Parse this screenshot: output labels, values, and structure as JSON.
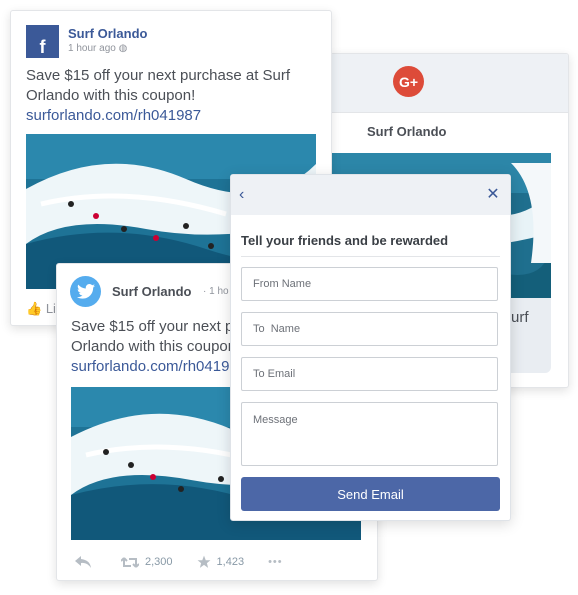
{
  "google_card": {
    "icon_label": "G+",
    "brand_color": "#dd4b39",
    "name": "Surf Orlando",
    "text_fragment": "urf"
  },
  "facebook_card": {
    "icon_label": "f",
    "brand_color": "#3b5998",
    "name": "Surf Orlando",
    "time": "1 hour ago",
    "text": "Save $15 off your next purchase at Surf Orlando with this coupon!",
    "link": "surforlando.com/rh041987",
    "like_label": "Li"
  },
  "twitter_card": {
    "brand_color": "#55acee",
    "name": "Surf Orlando",
    "time": "· 1 ho",
    "text": "Save $15 off your next purchase at Surf Orlando with this coupon!",
    "link": "surforlando.com/rh041987",
    "retweets": "2,300",
    "favorites": "1,423",
    "more": "•••"
  },
  "modal": {
    "back_icon": "‹",
    "close_icon": "✕",
    "title": "Tell your friends and be rewarded",
    "from_name_placeholder": "From Name",
    "to_name_placeholder": "To  Name",
    "to_email_placeholder": "To Email",
    "message_placeholder": "Message",
    "send_label": "Send Email",
    "accent_color": "#4c67a7"
  }
}
